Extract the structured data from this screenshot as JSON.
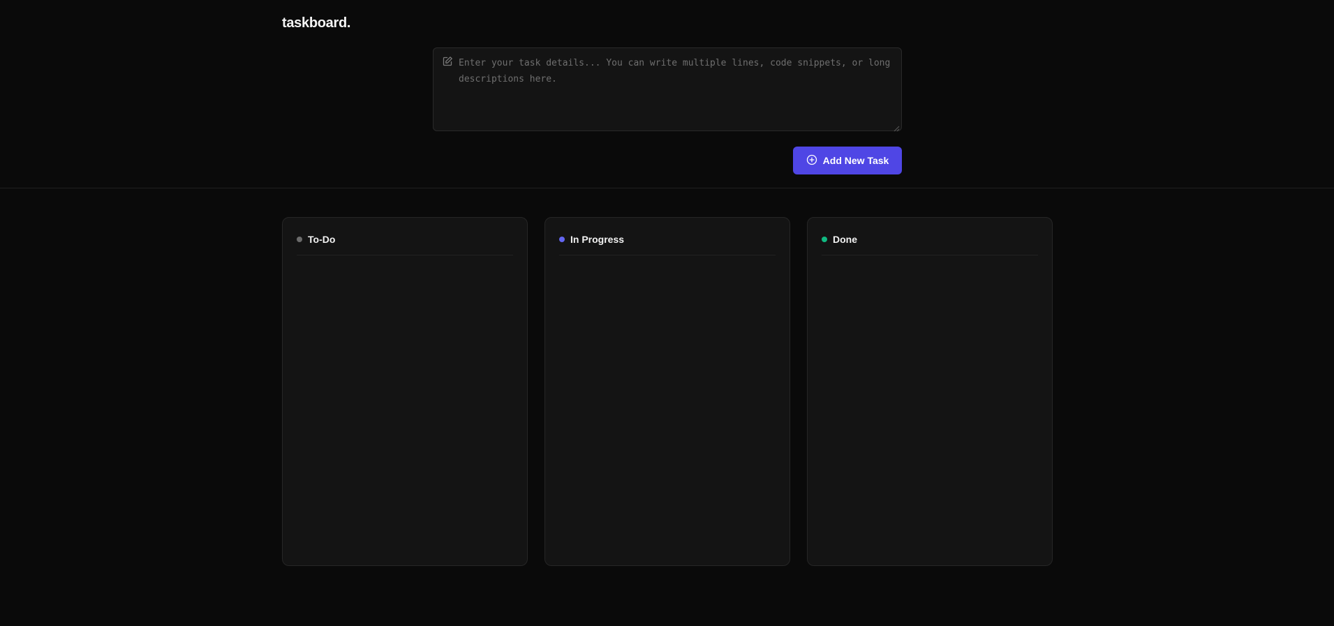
{
  "app": {
    "logo": "taskboard."
  },
  "composer": {
    "placeholder": "Enter your task details... You can write multiple lines, code snippets, or long descriptions here.",
    "value": "",
    "icon": "edit-icon"
  },
  "add_button": {
    "label": "Add New Task",
    "icon": "plus-circle-icon",
    "color": "#4f46e5"
  },
  "columns": [
    {
      "title": "To-Do",
      "dot_color": "#6b6b6b",
      "tasks": []
    },
    {
      "title": "In Progress",
      "dot_color": "#6366f1",
      "tasks": []
    },
    {
      "title": "Done",
      "dot_color": "#10b981",
      "tasks": []
    }
  ]
}
